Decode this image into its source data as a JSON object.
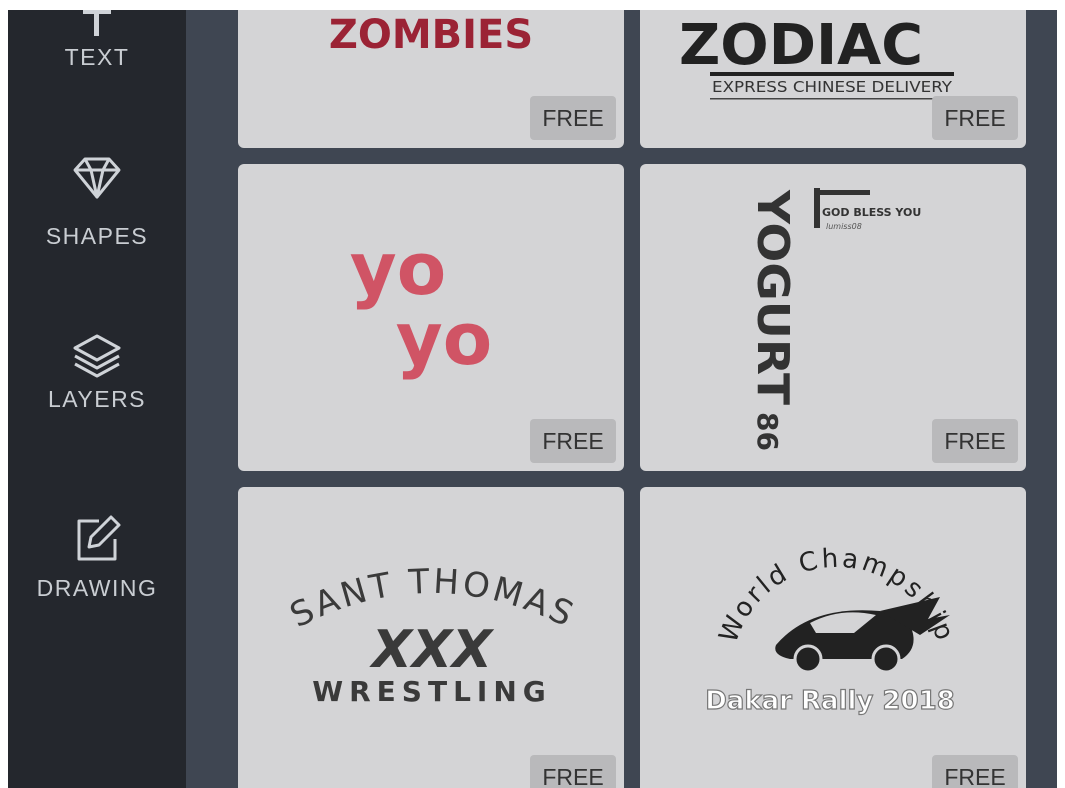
{
  "sidebar": {
    "items": [
      {
        "label": "TEXT",
        "icon": "text-icon"
      },
      {
        "label": "SHAPES",
        "icon": "diamond-icon"
      },
      {
        "label": "LAYERS",
        "icon": "layers-icon"
      },
      {
        "label": "DRAWING",
        "icon": "edit-icon"
      }
    ]
  },
  "cards": [
    {
      "title": "ZOMBIES",
      "badge": "FREE"
    },
    {
      "title": "ZODIAC",
      "subtitle": "EXPRESS CHINESE DELIVERY",
      "badge": "FREE"
    },
    {
      "line1": "yo",
      "line2": "yo",
      "badge": "FREE"
    },
    {
      "title": "YOGURT",
      "number": "86",
      "tagline": "GOD BLESS YOU",
      "signature": "lumiss08",
      "badge": "FREE"
    },
    {
      "arc": "SANT THOMAS",
      "mark": "XXX",
      "bottom": "WRESTLING",
      "badge": "FREE"
    },
    {
      "arc": "World Champship",
      "bottom": "Dakar Rally 2018",
      "badge": "FREE"
    }
  ],
  "colors": {
    "sidebar": "#24272d",
    "gallery": "#3f4652",
    "card": "#d4d4d6",
    "badge": "#b9b9bb",
    "zombies": "#9b2335",
    "yoyo": "#d05465"
  }
}
